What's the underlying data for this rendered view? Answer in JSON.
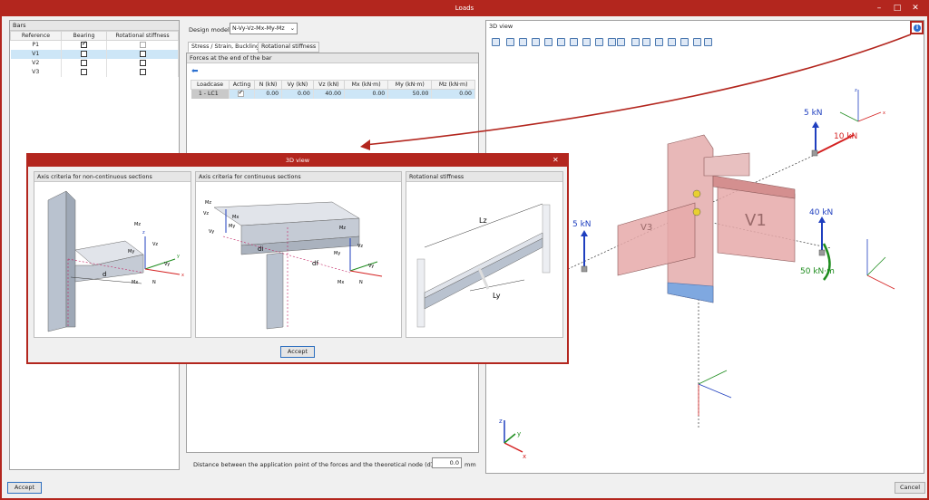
{
  "window": {
    "title": "Loads",
    "minimize_label": "–",
    "maximize_label": "□",
    "close_label": "✕"
  },
  "bars": {
    "title": "Bars",
    "columns": [
      "Reference",
      "Bearing",
      "Rotational stiffness"
    ],
    "rows": [
      {
        "ref": "P1",
        "bearing": true,
        "rot_disabled": true
      },
      {
        "ref": "V1",
        "bearing": false,
        "rot_disabled": false
      },
      {
        "ref": "V2",
        "bearing": false,
        "rot_disabled": false
      },
      {
        "ref": "V3",
        "bearing": false,
        "rot_disabled": false
      }
    ]
  },
  "design_model": {
    "label": "Design model",
    "value": "N-Vy-Vz-Mx-My-Mz"
  },
  "tabs": [
    "Stress / Strain, Buckling",
    "Rotational stiffness"
  ],
  "forces": {
    "title": "Forces at the end of the bar",
    "columns": [
      "Loadcase",
      "Acting",
      "N (kN)",
      "Vy (kN)",
      "Vz (kN)",
      "Mx (kN·m)",
      "My (kN·m)",
      "Mz (kN·m)"
    ],
    "rows": [
      {
        "loadcase": "1 - LC1",
        "acting": true,
        "N": "0.00",
        "Vy": "0.00",
        "Vz": "40.00",
        "Mx": "0.00",
        "My": "50.00",
        "Mz": "0.00"
      }
    ]
  },
  "distance": {
    "label": "Distance between the application point of the forces and the theoretical node (d)",
    "value": "0.0",
    "unit": "mm"
  },
  "view3d": {
    "title": "3D view",
    "info_icon": "info-icon",
    "labels": {
      "f5a": "5 kN",
      "f10": "10 kN",
      "f5b": "5 kN",
      "f40": "40 kN",
      "m50": "50 kN·m",
      "v1": "V1",
      "v3": "V3",
      "axx": "x",
      "axy": "y",
      "axz": "z"
    }
  },
  "modal": {
    "title": "3D view",
    "close_label": "✕",
    "panels": [
      "Axis criteria for non-continuous sections",
      "Axis criteria for continuous sections",
      "Rotational stiffness"
    ],
    "fig1": {
      "d": "d",
      "mz": "Mz",
      "vz": "Vz",
      "my": "My",
      "vy": "Vy",
      "mx": "Mx",
      "n": "N",
      "z": "z",
      "y": "y",
      "x": "x"
    },
    "fig2": {
      "di": "di",
      "df": "df",
      "mz": "Mz",
      "vz": "Vz",
      "my": "My",
      "vy": "Vy",
      "mx": "Mx",
      "n": "N"
    },
    "fig3": {
      "lz": "Lz",
      "ly": "Ly"
    },
    "accept_label": "Accept"
  },
  "footer": {
    "accept_label": "Accept",
    "cancel_label": "Cancel"
  },
  "colors": {
    "frame": "#b3261e",
    "force_blue": "#1f3fbf",
    "force_red": "#d42020",
    "moment_green": "#1e8c1e"
  }
}
